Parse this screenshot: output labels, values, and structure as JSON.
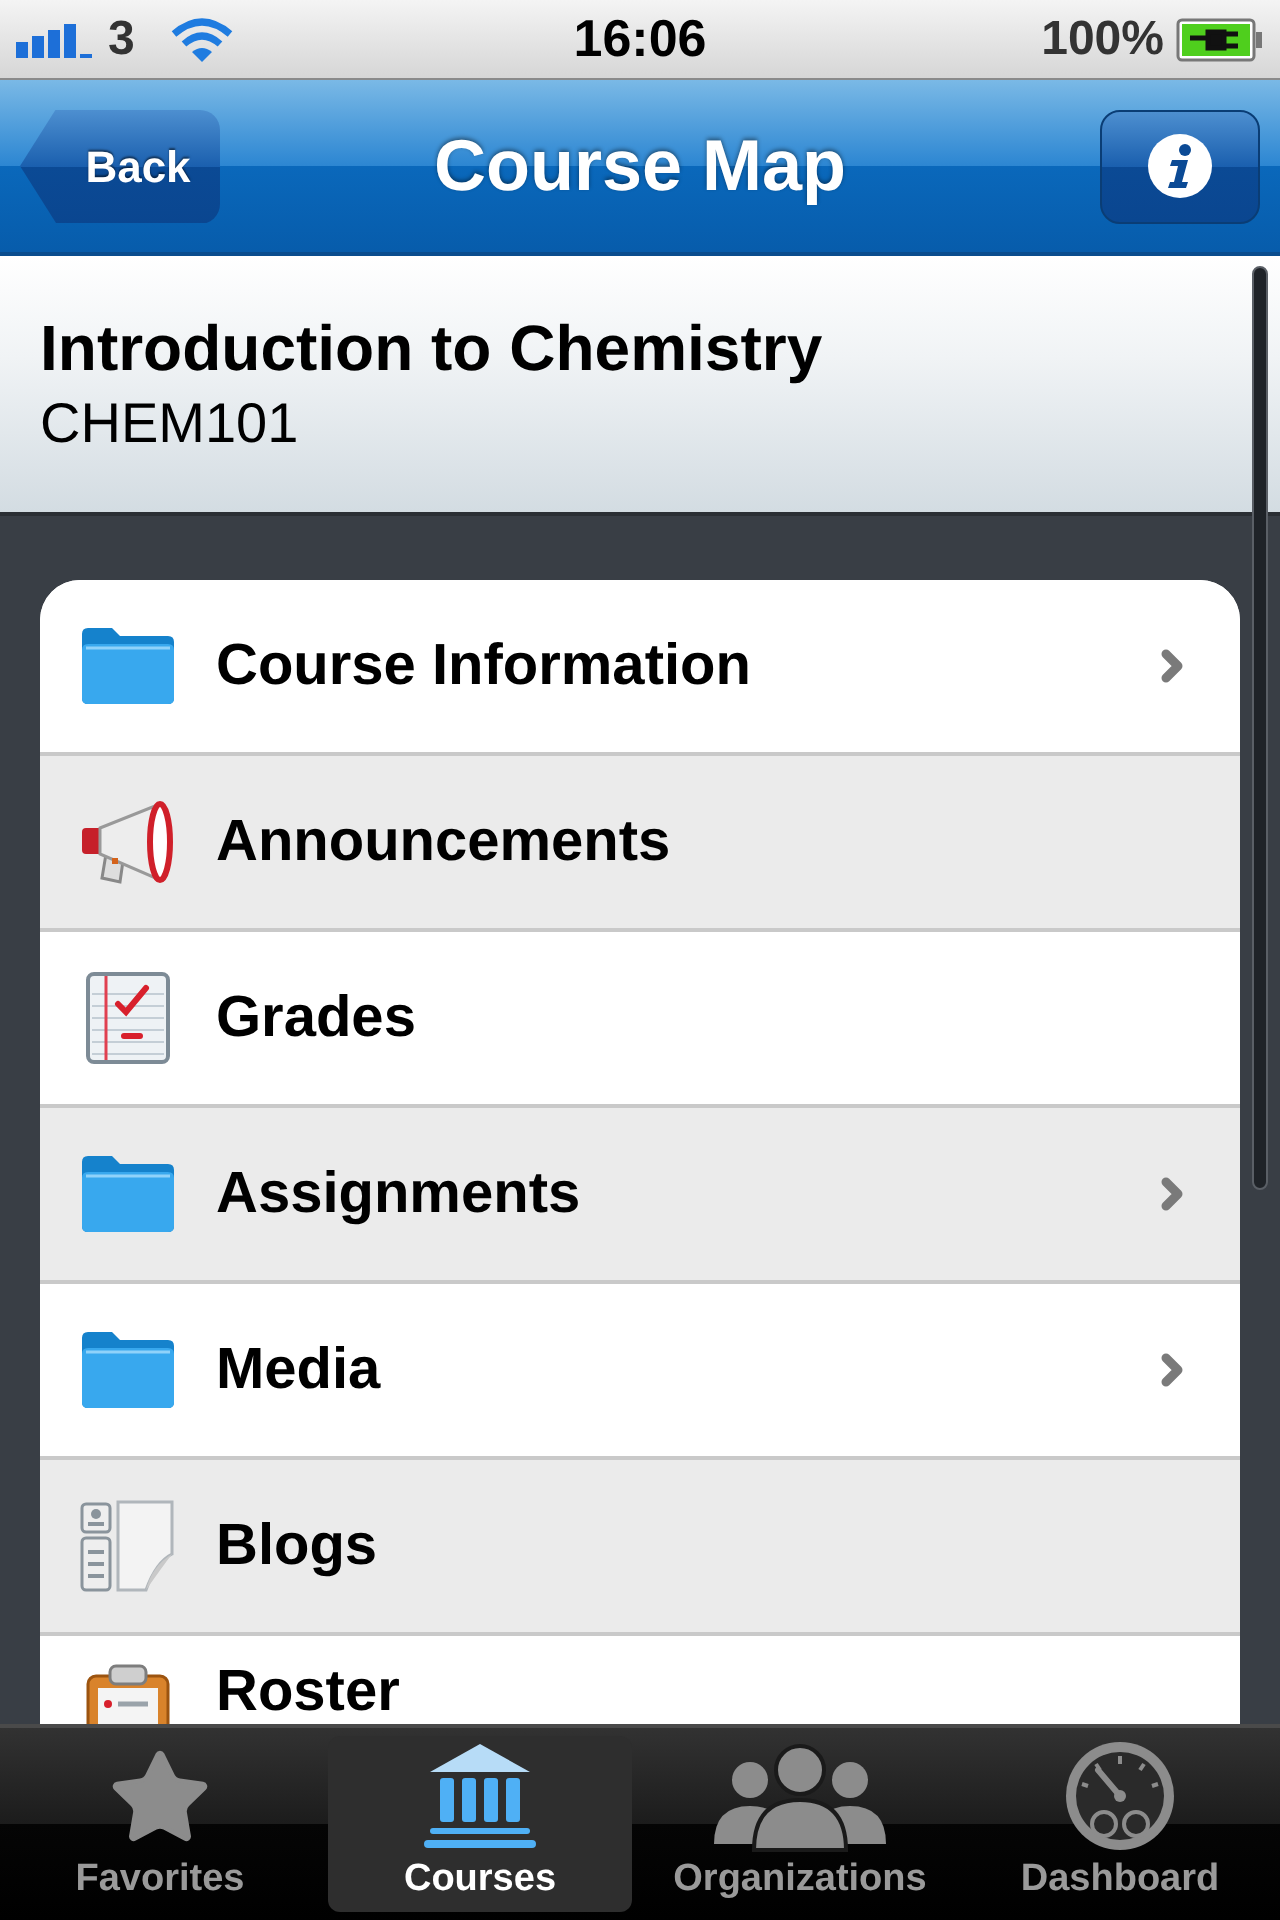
{
  "status_bar": {
    "carrier": "3",
    "time": "16:06",
    "battery": "100%"
  },
  "nav_bar": {
    "back": "Back",
    "title": "Course Map"
  },
  "course": {
    "title": "Introduction to Chemistry",
    "code": "CHEM101"
  },
  "menu": [
    {
      "label": "Course Information",
      "kind": "folder",
      "disclosure": true
    },
    {
      "label": "Announcements",
      "kind": "megaphone",
      "disclosure": false
    },
    {
      "label": "Grades",
      "kind": "notepad",
      "disclosure": false
    },
    {
      "label": "Assignments",
      "kind": "folder",
      "disclosure": true
    },
    {
      "label": "Media",
      "kind": "folder",
      "disclosure": true
    },
    {
      "label": "Blogs",
      "kind": "document",
      "disclosure": false
    },
    {
      "label": "Roster",
      "kind": "clipboard",
      "disclosure": false
    }
  ],
  "tab_bar": [
    {
      "label": "Favorites",
      "kind": "star",
      "selected": false
    },
    {
      "label": "Courses",
      "kind": "institution",
      "selected": true
    },
    {
      "label": "Organizations",
      "kind": "people",
      "selected": false
    },
    {
      "label": "Dashboard",
      "kind": "gauge",
      "selected": false
    }
  ]
}
